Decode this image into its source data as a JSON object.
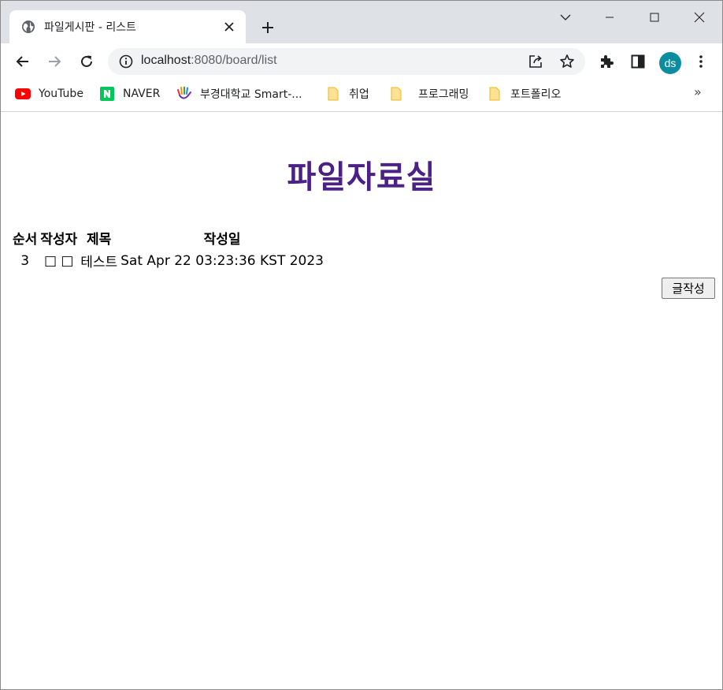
{
  "browser": {
    "tab": {
      "title": "파일게시판 - 리스트",
      "favicon": "globe-icon"
    },
    "address": {
      "host": "localhost",
      "rest": ":8080/board/list"
    },
    "avatar": "ds",
    "bookmarks": [
      {
        "label": "YouTube",
        "icon": "youtube-icon"
      },
      {
        "label": "NAVER",
        "icon": "naver-icon"
      },
      {
        "label": "부경대학교 Smart-...",
        "icon": "hand-logo-icon"
      },
      {
        "label": "취업",
        "icon": "folder-icon"
      },
      {
        "label": "프로그래밍",
        "icon": "folder-icon"
      },
      {
        "label": "포트폴리오",
        "icon": "folder-icon"
      }
    ],
    "bookmarks_more": "»"
  },
  "page": {
    "title": "파일자료실",
    "table": {
      "headers": [
        "순서",
        "작성자",
        "제목",
        "작성일"
      ],
      "rows": [
        [
          "3",
          "□ □",
          "테스트",
          "Sat Apr 22 03:23:36 KST 2023"
        ]
      ]
    },
    "write_button": "글작성"
  },
  "colors": {
    "title": "#4b2185",
    "tabstrip": "#dee1e6",
    "avatar": "#0b8d9f"
  }
}
